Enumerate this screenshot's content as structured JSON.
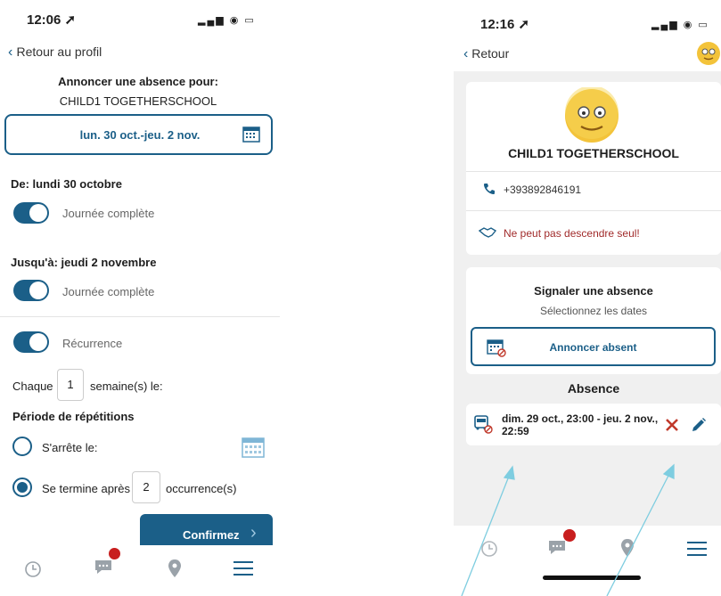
{
  "left": {
    "status": {
      "time": "12:06 ➚",
      "icons": "▂▄▆ ◉ ▭"
    },
    "back_label": "Retour au profil",
    "heading": "Annoncer une absence pour:",
    "child_name": "CHILD1 TOGETHERSCHOOL",
    "date_range": "lun. 30 oct.-jeu. 2 nov.",
    "from_label": "De: lundi 30 octobre",
    "full_day_label_1": "Journée complète",
    "to_label": "Jusqu'à: jeudi 2 novembre",
    "full_day_label_2": "Journée complète",
    "recurrence_label": "Récurrence",
    "every_label": "Chaque",
    "every_value": "1",
    "weeks_label": "semaine(s) le:",
    "period_label": "Période de répétitions",
    "stops_on_label": "S'arrête le:",
    "ends_after_label": "Se termine après",
    "ends_after_value": "2",
    "occurrences_label": "occurrence(s)",
    "confirm_label": "Confirmez",
    "confirm_arrow": "›"
  },
  "right": {
    "status": {
      "time": "12:16 ➚",
      "icons": "▂▄▆ ◉ ▭"
    },
    "back_label": "Retour",
    "child_name": "CHILD1 TOGETHERSCHOOL",
    "phone": "+393892846191",
    "warning": "Ne peut pas descendre seul!",
    "report_title": "Signaler une absence",
    "report_subtitle": "Sélectionnez les dates",
    "announce_label": "Annoncer absent",
    "absence_heading": "Absence",
    "absence_text_1": "dim. 29 oct., 23:00 - jeu. 2 nov.,",
    "absence_text_2": "22:59"
  },
  "icons": {
    "back": "chevron-left-icon",
    "calendar": "calendar-icon",
    "clock": "clock-icon",
    "chat": "chat-icon",
    "pin": "location-pin-icon",
    "menu": "menu-icon",
    "phone": "phone-icon",
    "handshake": "handshake-icon",
    "bus": "bus-icon",
    "delete": "delete-icon",
    "edit": "edit-icon",
    "avatar": "smiley-avatar-icon"
  },
  "colors": {
    "primary": "#1b5f88",
    "danger": "#c0392b",
    "notification": "#c81e1e",
    "annotation_arrow": "#7ecde0"
  }
}
